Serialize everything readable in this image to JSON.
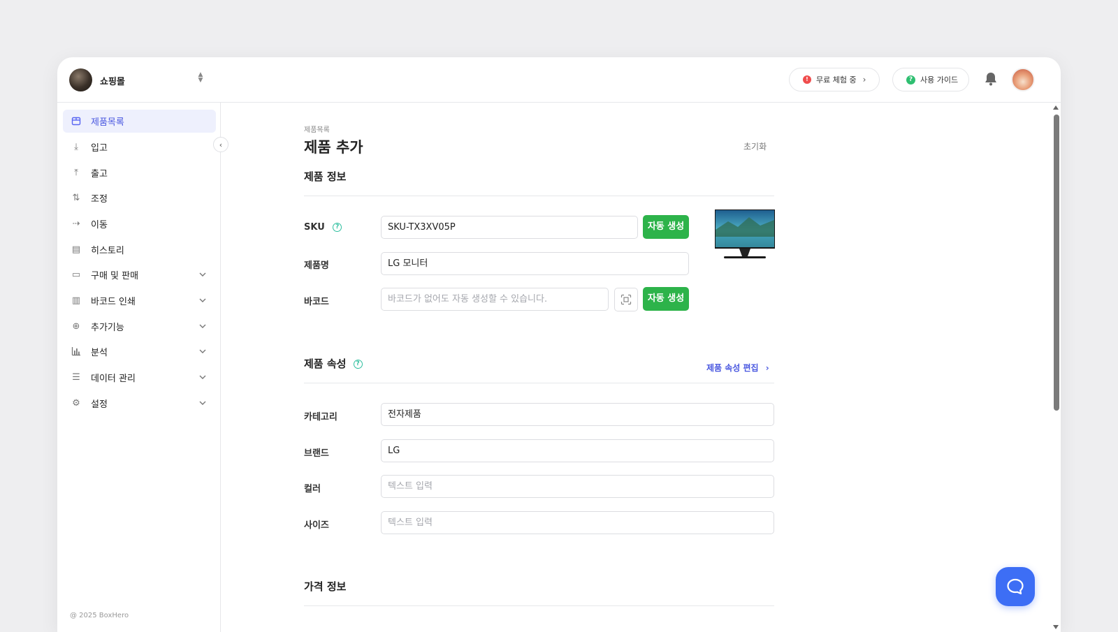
{
  "header": {
    "shop_name": "쇼핑몰",
    "trial_badge": "!",
    "trial_label": "무료 체험 중",
    "guide_badge": "?",
    "guide_label": "사용 가이드"
  },
  "sidebar": {
    "items": [
      {
        "label": "제품목록",
        "icon": "box-icon",
        "active": true
      },
      {
        "label": "입고",
        "icon": "arrow-down-icon"
      },
      {
        "label": "출고",
        "icon": "arrow-up-icon"
      },
      {
        "label": "조정",
        "icon": "swap-icon"
      },
      {
        "label": "이동",
        "icon": "arrow-right-icon"
      },
      {
        "label": "히스토리",
        "icon": "history-icon"
      },
      {
        "label": "구매 및 판매",
        "icon": "document-icon",
        "expandable": true
      },
      {
        "label": "바코드 인쇄",
        "icon": "barcode-icon",
        "expandable": true
      },
      {
        "label": "추가기능",
        "icon": "plus-circle-icon",
        "expandable": true
      },
      {
        "label": "분석",
        "icon": "bar-chart-icon",
        "expandable": true
      },
      {
        "label": "데이터 관리",
        "icon": "database-icon",
        "expandable": true
      },
      {
        "label": "설정",
        "icon": "gear-icon",
        "expandable": true
      }
    ],
    "copyright": "@ 2025 BoxHero"
  },
  "main": {
    "breadcrumb": "제품목록",
    "title": "제품 추가",
    "reset_label": "초기화",
    "product_info": {
      "section_title": "제품 정보",
      "sku_label": "SKU",
      "sku_value": "SKU-TX3XV05P",
      "sku_generate": "자동 생성",
      "name_label": "제품명",
      "name_value": "LG 모니터",
      "barcode_label": "바코드",
      "barcode_placeholder": "바코드가 없어도 자동 생성할 수 있습니다.",
      "barcode_generate": "자동 생성"
    },
    "attributes": {
      "section_title": "제품 속성",
      "edit_link": "제품 속성 편집",
      "category_label": "카테고리",
      "category_value": "전자제품",
      "brand_label": "브랜드",
      "brand_value": "LG",
      "color_label": "컬러",
      "color_placeholder": "텍스트 입력",
      "size_label": "사이즈",
      "size_placeholder": "텍스트 입력"
    },
    "price": {
      "section_title": "가격 정보"
    }
  },
  "colors": {
    "accent": "#4a58e0",
    "primary_green": "#2db34a",
    "chat_blue": "#3d6ef5"
  }
}
